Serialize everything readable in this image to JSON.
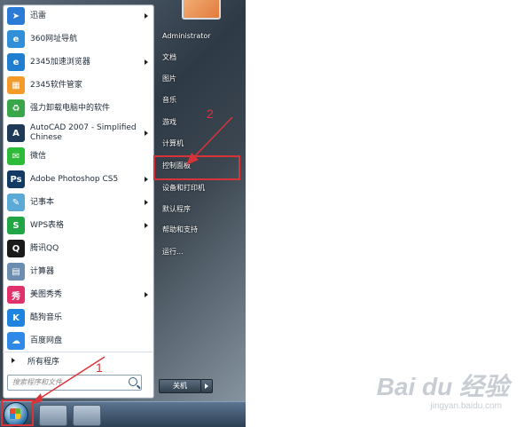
{
  "programs": [
    {
      "label": "迅雷",
      "icon": "thunder-icon",
      "color": "#2a7ad6",
      "glyph": "➤",
      "arrow": true
    },
    {
      "label": "360网址导航",
      "icon": "ie-icon",
      "color": "#2f8fd8",
      "glyph": "e",
      "arrow": false
    },
    {
      "label": "2345加速浏览器",
      "icon": "browser-2345-icon",
      "color": "#1f7ecf",
      "glyph": "e",
      "arrow": true
    },
    {
      "label": "2345软件管家",
      "icon": "software-manager-icon",
      "color": "#f29b2a",
      "glyph": "▦",
      "arrow": false
    },
    {
      "label": "强力卸载电脑中的软件",
      "icon": "uninstall-icon",
      "color": "#3aa64a",
      "glyph": "♻",
      "arrow": false
    },
    {
      "label": "AutoCAD 2007 - Simplified Chinese",
      "icon": "autocad-icon",
      "color": "#1e3a58",
      "glyph": "A",
      "arrow": true
    },
    {
      "label": "微信",
      "icon": "wechat-icon",
      "color": "#2dbb3a",
      "glyph": "✉",
      "arrow": false
    },
    {
      "label": "Adobe Photoshop CS5",
      "icon": "photoshop-icon",
      "color": "#123a63",
      "glyph": "Ps",
      "arrow": true
    },
    {
      "label": "记事本",
      "icon": "notepad-icon",
      "color": "#5aa9d6",
      "glyph": "✎",
      "arrow": true
    },
    {
      "label": "WPS表格",
      "icon": "wps-icon",
      "color": "#21a545",
      "glyph": "S",
      "arrow": true
    },
    {
      "label": "腾讯QQ",
      "icon": "qq-icon",
      "color": "#1a1a1a",
      "glyph": "Q",
      "arrow": false
    },
    {
      "label": "计算器",
      "icon": "calculator-icon",
      "color": "#6b8db0",
      "glyph": "▤",
      "arrow": false
    },
    {
      "label": "美图秀秀",
      "icon": "meitu-icon",
      "color": "#e0316a",
      "glyph": "秀",
      "arrow": true
    },
    {
      "label": "酷狗音乐",
      "icon": "kugou-icon",
      "color": "#1f83e0",
      "glyph": "K",
      "arrow": false
    },
    {
      "label": "百度网盘",
      "icon": "baidu-netdisk-icon",
      "color": "#2e8ae6",
      "glyph": "☁",
      "arrow": false
    }
  ],
  "all_programs_label": "所有程序",
  "search": {
    "placeholder": "搜索程序和文件"
  },
  "right_items": [
    {
      "label": "Administrator",
      "name": "right-item-administrator"
    },
    {
      "label": "文档",
      "name": "right-item-documents"
    },
    {
      "label": "图片",
      "name": "right-item-pictures"
    },
    {
      "label": "音乐",
      "name": "right-item-music"
    },
    {
      "label": "游戏",
      "name": "right-item-games"
    },
    {
      "label": "计算机",
      "name": "right-item-computer"
    },
    {
      "label": "控制面板",
      "name": "right-item-control-panel"
    },
    {
      "label": "设备和打印机",
      "name": "right-item-devices-printers"
    },
    {
      "label": "默认程序",
      "name": "right-item-default-programs"
    },
    {
      "label": "帮助和支持",
      "name": "right-item-help-support"
    },
    {
      "label": "运行...",
      "name": "right-item-run"
    }
  ],
  "shutdown_label": "关机",
  "annotations": {
    "step1": "1",
    "step2": "2",
    "color": "#d9333a"
  },
  "watermark": {
    "text": "Bai du 经验",
    "sub": "jingyan.baidu.com"
  }
}
